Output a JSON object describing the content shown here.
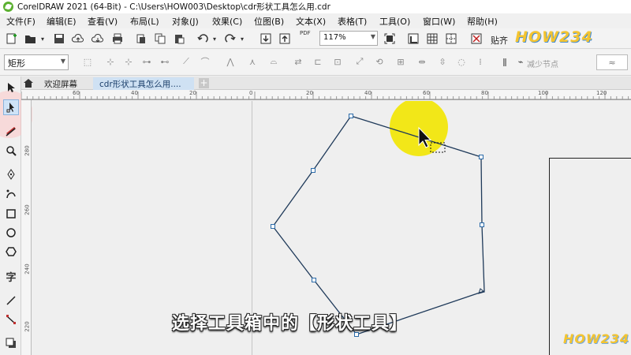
{
  "window": {
    "title": "CorelDRAW 2021 (64-Bit) - C:\\Users\\HOW003\\Desktop\\cdr形状工具怎么用.cdr"
  },
  "menu": [
    "文件(F)",
    "编辑(E)",
    "查看(V)",
    "布局(L)",
    "对象(J)",
    "效果(C)",
    "位图(B)",
    "文本(X)",
    "表格(T)",
    "工具(O)",
    "窗口(W)",
    "帮助(H)"
  ],
  "toolbar": {
    "zoom_value": "117%",
    "pdf_label": "PDF",
    "align_label": "贴齐"
  },
  "property_bar": {
    "shape_type": "矩形",
    "reduce_nodes": "减少节点"
  },
  "tabs": [
    {
      "label": "欢迎屏幕",
      "active": false
    },
    {
      "label": "cdr形状工具怎么用....",
      "active": true
    }
  ],
  "rulers": {
    "h_labels": [
      "60",
      "40",
      "20",
      "0",
      "20",
      "40",
      "60",
      "80",
      "100",
      "120"
    ],
    "v_labels": [
      "280",
      "260",
      "240",
      "220"
    ]
  },
  "subtitle": "选择工具箱中的【形状工具】",
  "watermark": "HOW234",
  "colors": {
    "shape_stroke": "#1f3a5a",
    "node": "#2a6aa8",
    "highlight": "#f2e600",
    "tab_active": "#cfe1f3"
  }
}
